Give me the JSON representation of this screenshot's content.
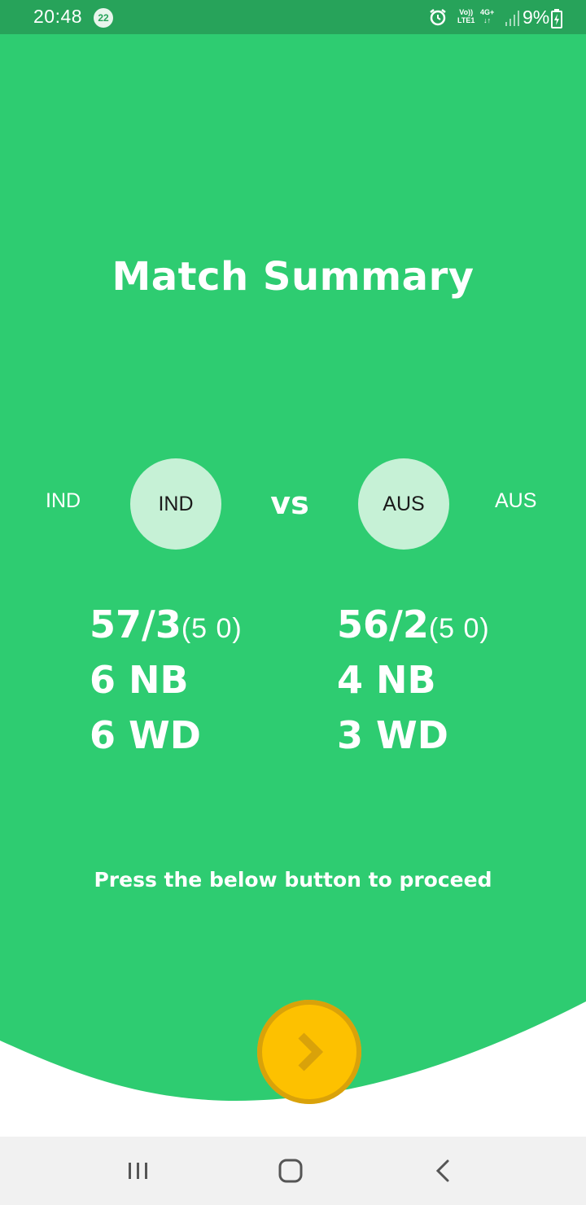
{
  "status_bar": {
    "time": "20:48",
    "notification_count": "22",
    "volte_label": [
      "Vo))",
      "LTE1"
    ],
    "network_label": [
      "4G+",
      "↓↑"
    ],
    "battery_percent": "9%",
    "background_color": "#27a35a"
  },
  "screen": {
    "title": "Match Summary",
    "background_color": "#2ecc71",
    "accent_color": "#fdc100"
  },
  "teams": {
    "left": {
      "name": "IND",
      "badge": "IND"
    },
    "right": {
      "name": "AUS",
      "badge": "AUS"
    },
    "vs_label": "vs"
  },
  "scores": {
    "left": {
      "score": "57/3",
      "overs": "(5 0)",
      "no_balls": "6 NB",
      "wides": "6 WD"
    },
    "right": {
      "score": "56/2",
      "overs": "(5 0)",
      "no_balls": "4 NB",
      "wides": "3 WD"
    }
  },
  "instruction": "Press the below button to proceed",
  "icons": {
    "next_button": "chevron-right-icon",
    "nav_recents": "recents-icon",
    "nav_home": "home-icon",
    "nav_back": "back-icon"
  }
}
